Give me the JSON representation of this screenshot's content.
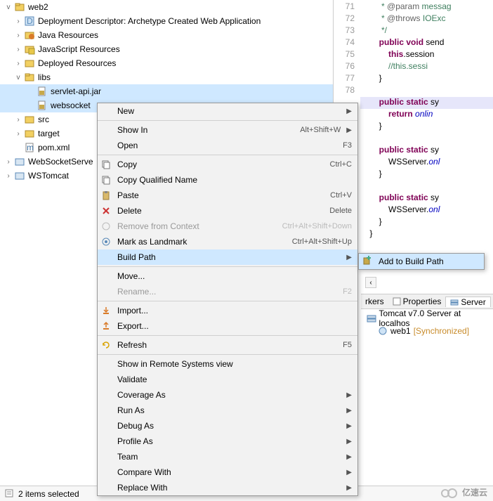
{
  "tree": {
    "root": "web2",
    "items": [
      "Deployment Descriptor: Archetype Created Web Application",
      "Java Resources",
      "JavaScript Resources",
      "Deployed Resources"
    ],
    "libs": "libs",
    "libFiles": [
      "servlet-api.jar",
      "websocket"
    ],
    "after": [
      "src",
      "target"
    ],
    "pom": "pom.xml",
    "projects": [
      "WebSocketServe",
      "WSTomcat"
    ]
  },
  "menu": {
    "new": "New",
    "showIn": {
      "label": "Show In",
      "accel": "Alt+Shift+W"
    },
    "open": {
      "label": "Open",
      "accel": "F3"
    },
    "copy": {
      "label": "Copy",
      "accel": "Ctrl+C"
    },
    "copyQ": "Copy Qualified Name",
    "paste": {
      "label": "Paste",
      "accel": "Ctrl+V"
    },
    "delete": {
      "label": "Delete",
      "accel": "Delete"
    },
    "removeCtx": {
      "label": "Remove from Context",
      "accel": "Ctrl+Alt+Shift+Down"
    },
    "landmark": {
      "label": "Mark as Landmark",
      "accel": "Ctrl+Alt+Shift+Up"
    },
    "buildPath": "Build Path",
    "move": "Move...",
    "rename": {
      "label": "Rename...",
      "accel": "F2"
    },
    "import": "Import...",
    "export": "Export...",
    "refresh": {
      "label": "Refresh",
      "accel": "F5"
    },
    "showRemote": "Show in Remote Systems view",
    "validate": "Validate",
    "coverage": "Coverage As",
    "runAs": "Run As",
    "debugAs": "Debug As",
    "profileAs": "Profile As",
    "team": "Team",
    "compare": "Compare With",
    "replace": "Replace With"
  },
  "submenu": {
    "addToBuild": "Add to Build Path"
  },
  "code": {
    "lines": [
      {
        "n": "71",
        "t": "         * @param messag",
        "cls": "cm"
      },
      {
        "n": "72",
        "t": "         * @throws IOExc",
        "cls": "cm"
      },
      {
        "n": "73",
        "t": "         */",
        "cls": "cm"
      },
      {
        "n": "74",
        "raw": "public void send"
      },
      {
        "n": "75",
        "raw": "this.session"
      },
      {
        "n": "76",
        "t": "            //this.sessi",
        "cls": "cm"
      },
      {
        "n": "77",
        "t": "        }"
      },
      {
        "n": "78",
        "t": ""
      },
      {
        "n": "",
        "raw": "public static sy",
        "hl": true
      },
      {
        "n": "",
        "raw": "return onlin"
      },
      {
        "n": "",
        "t": "        }"
      },
      {
        "n": "",
        "t": ""
      },
      {
        "n": "",
        "raw": "public static sy"
      },
      {
        "n": "",
        "raw": "WSServer.onl"
      },
      {
        "n": "",
        "t": "        }"
      },
      {
        "n": "",
        "t": ""
      },
      {
        "n": "",
        "raw": "public static sy"
      },
      {
        "n": "",
        "raw": "WSServer.onl"
      },
      {
        "n": "",
        "t": "        }"
      },
      {
        "n": "",
        "t": "    }"
      }
    ]
  },
  "tabs": {
    "markers": "rkers",
    "properties": "Properties",
    "servers": "Server"
  },
  "servers": {
    "tomcat": "Tomcat v7.0 Server at localhos",
    "web1": "web1",
    "sync": "[Synchronized]"
  },
  "status": "2 items selected",
  "watermark": "亿速云"
}
